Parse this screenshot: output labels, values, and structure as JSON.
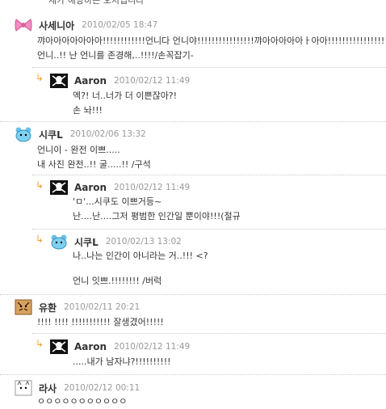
{
  "top_cutoff": "제가 해당하는 오지입니다",
  "comments": [
    {
      "id": "c1",
      "icon": "pink-bow-icon",
      "name": "사세니아",
      "date": "2010/02/05 18:47",
      "lines": [
        "꺄아아아아아아아!!!!!!!!!!!!언니다 언니야!!!!!!!!!!!!!!!!꺄아아아아아ㅏ아아!!!!!!!!!!!!!!!!!",
        "언니..!! 난 언니를 존경해,..!!!!/손꼭잡기-"
      ]
    },
    {
      "id": "r1",
      "icon": "pirate-flag-icon",
      "name": "Aaron",
      "date": "2010/02/12 11:49",
      "lines": [
        "엑?! 너..너가 더 이쁜잖아?!",
        "손 놔!!!"
      ]
    },
    {
      "id": "c2",
      "icon": "blue-bear-icon",
      "name": "시쿠L",
      "date": "2010/02/06 13:32",
      "lines": [
        "언니이 - 완전 이쁘.....",
        "내 사진 완전..!! 굴.....!! /구석"
      ]
    },
    {
      "id": "r2",
      "icon": "pirate-flag-icon",
      "name": "Aaron",
      "date": "2010/02/12 11:49",
      "lines": [
        "'ㅁ'...시쿠도 이쁘거등~",
        "난....난....그저 평범한 인간일 뿐이야!!!(절규"
      ]
    },
    {
      "id": "r3",
      "icon": "blue-bear-icon",
      "name": "시쿠L",
      "date": "2010/02/13 13:02",
      "lines": [
        "나..나는 인간이 아니라는 거..!!! <?",
        "",
        "언니 잇쁘.!!!!!!!! /버럭"
      ]
    },
    {
      "id": "c3",
      "icon": "tiger-icon",
      "name": "유환",
      "date": "2010/02/11 20:21",
      "lines": [
        "!!!! !!!! !!!!!!!!!!! 잘생겼어!!!!!"
      ]
    },
    {
      "id": "r4",
      "icon": "pirate-flag-icon",
      "name": "Aaron",
      "date": "2010/02/12 11:49",
      "lines": [
        ".....내가 남자냐?!!!!!!!!!!"
      ]
    },
    {
      "id": "c4",
      "icon": "white-cat-icon",
      "name": "라사",
      "date": "2010/02/12 00:11",
      "lines": [
        "ㅇㅇㅇㅇㅇㅇㅇㅇㅇㅇㅇ"
      ]
    }
  ],
  "reply_marker": "↳",
  "colors": {
    "date": "#999999",
    "reply_arrow": "#f0a030",
    "separator": "#c8c8c8"
  }
}
